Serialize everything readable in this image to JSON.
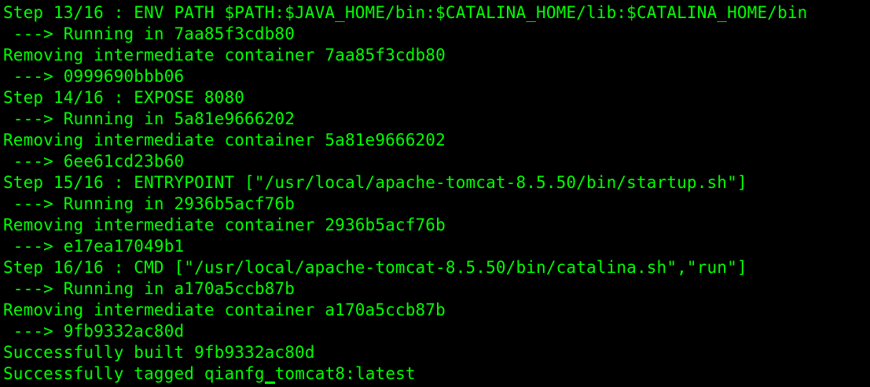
{
  "terminal": {
    "lines": [
      "Step 13/16 : ENV PATH $PATH:$JAVA_HOME/bin:$CATALINA_HOME/lib:$CATALINA_HOME/bin",
      " ---> Running in 7aa85f3cdb80",
      "Removing intermediate container 7aa85f3cdb80",
      " ---> 0999690bbb06",
      "Step 14/16 : EXPOSE 8080",
      " ---> Running in 5a81e9666202",
      "Removing intermediate container 5a81e9666202",
      " ---> 6ee61cd23b60",
      "Step 15/16 : ENTRYPOINT [\"/usr/local/apache-tomcat-8.5.50/bin/startup.sh\"]",
      " ---> Running in 2936b5acf76b",
      "Removing intermediate container 2936b5acf76b",
      " ---> e17ea17049b1",
      "Step 16/16 : CMD [\"/usr/local/apache-tomcat-8.5.50/bin/catalina.sh\",\"run\"]",
      " ---> Running in a170a5ccb87b",
      "Removing intermediate container a170a5ccb87b",
      " ---> 9fb9332ac80d",
      "Successfully built 9fb9332ac80d"
    ],
    "last_line_before_cursor": "Successfully tagged qianfg",
    "last_line_after_cursor": "tomcat8:latest",
    "text_color": "#00ff00",
    "background_color": "#000000"
  }
}
